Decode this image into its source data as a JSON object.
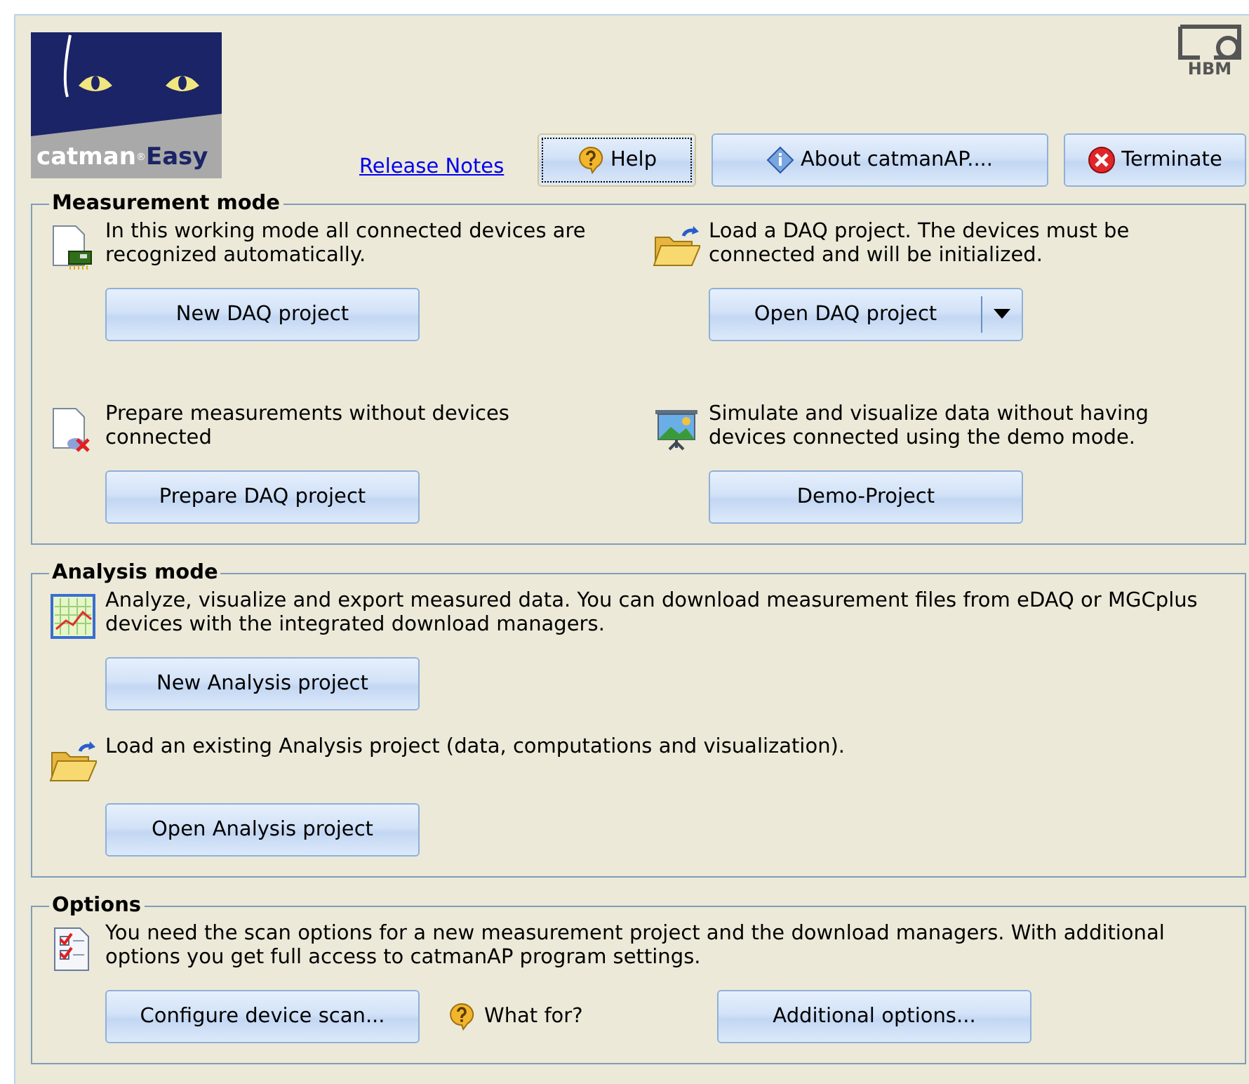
{
  "header": {
    "logo": {
      "brand": "catman",
      "mark": "®",
      "edition": "Easy"
    },
    "company_logo": "HBM",
    "release_notes_link": "Release Notes",
    "buttons": [
      {
        "label": "Help",
        "kind": "help",
        "focused": true
      },
      {
        "label": "About catmanAP....",
        "kind": "info",
        "focused": false
      },
      {
        "label": "Terminate",
        "kind": "terminate",
        "focused": false
      }
    ]
  },
  "sections": [
    {
      "title": "Measurement mode",
      "kind": "grid",
      "items": [
        {
          "kind": "device",
          "text": "In this working mode all connected devices are recognized automatically.",
          "controls": [
            {
              "kind": "button",
              "label": "New DAQ project"
            }
          ]
        },
        {
          "kind": "folder",
          "text": "Load a DAQ project. The devices must be connected and will be initialized.",
          "controls": [
            {
              "kind": "split-button",
              "label": "Open DAQ project"
            }
          ]
        },
        {
          "kind": "offline",
          "text": "Prepare measurements without devices connected",
          "controls": [
            {
              "kind": "button",
              "label": "Prepare DAQ project"
            }
          ]
        },
        {
          "kind": "presentation",
          "text": "Simulate and visualize data without having devices connected using the demo mode.",
          "controls": [
            {
              "kind": "button",
              "label": "Demo-Project"
            }
          ]
        }
      ]
    },
    {
      "title": "Analysis mode",
      "kind": "list",
      "items": [
        {
          "kind": "chart",
          "text": "Analyze, visualize and export measured data. You can download measurement files from eDAQ or MGCplus devices with the integrated download managers.",
          "controls": [
            {
              "kind": "button",
              "label": "New Analysis project"
            }
          ]
        },
        {
          "kind": "folder",
          "text": "Load an existing Analysis project (data, computations and visualization).",
          "controls": [
            {
              "kind": "button",
              "label": "Open Analysis project"
            }
          ]
        }
      ]
    },
    {
      "title": "Options",
      "kind": "list",
      "items": [
        {
          "kind": "checklist",
          "text": "You need the scan options for a new measurement project and the download managers. With additional options you get full access to catmanAP program settings.",
          "controls": [
            {
              "kind": "button",
              "label": "Configure device scan..."
            },
            {
              "kind": "hint",
              "label": "What for?"
            },
            {
              "kind": "button",
              "label": "Additional options..."
            }
          ]
        }
      ]
    }
  ]
}
